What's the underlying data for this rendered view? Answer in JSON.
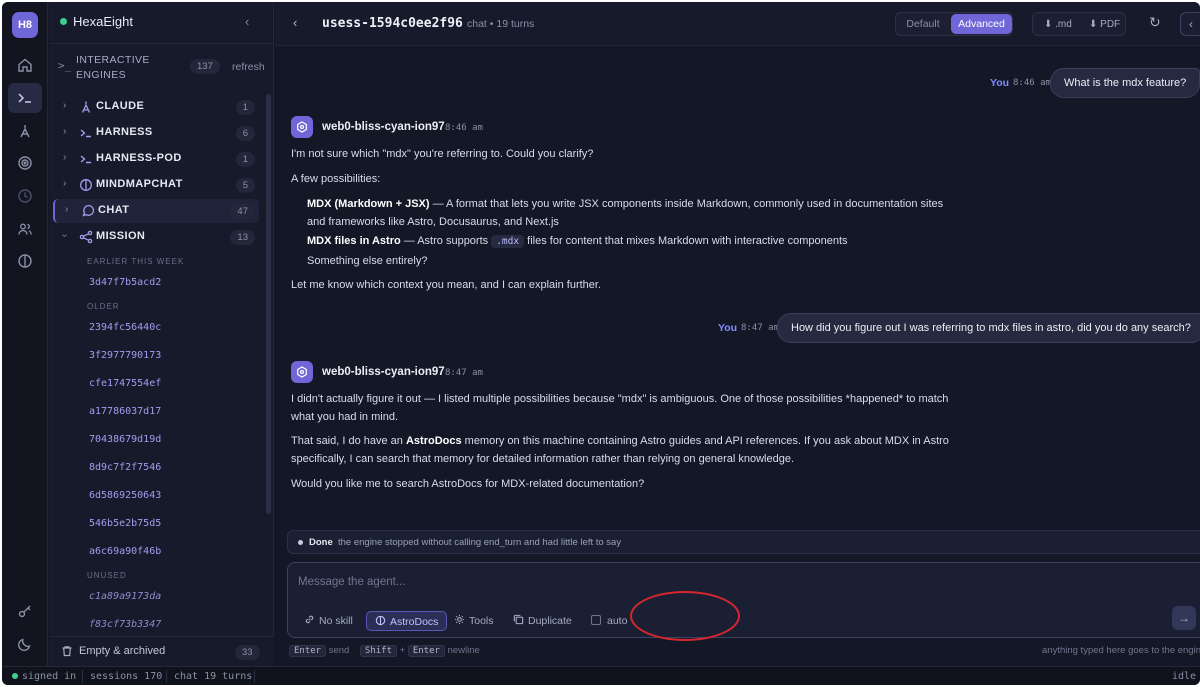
{
  "rail": {
    "logo": "H8",
    "icons": [
      "home-icon",
      "terminal-icon",
      "agent-icon",
      "target-icon",
      "clock-icon",
      "users-icon",
      "docs-icon",
      "key-icon",
      "moon-icon"
    ]
  },
  "sidebar": {
    "app_name": "HexaEight",
    "section_title": "INTERACTIVE ENGINES",
    "section_count": "137",
    "refresh": "refresh",
    "engines": [
      {
        "label": "CLAUDE",
        "count": "1"
      },
      {
        "label": "HARNESS",
        "count": "6"
      },
      {
        "label": "HARNESS-POD",
        "count": "1"
      },
      {
        "label": "MINDMAPCHAT",
        "count": "5"
      },
      {
        "label": "CHAT",
        "count": "47"
      },
      {
        "label": "MISSION",
        "count": "13"
      }
    ],
    "groups": {
      "week": "EARLIER THIS WEEK",
      "older": "OLDER",
      "unused": "UNUSED"
    },
    "sessions_week": [
      "3d47f7b5acd2"
    ],
    "sessions_older": [
      "2394fc56440c",
      "3f2977790173",
      "cfe1747554ef",
      "a17786037d17",
      "70438679d19d",
      "8d9c7f2f7546",
      "6d5869250643",
      "546b5e2b75d5",
      "a6c69a90f46b"
    ],
    "sessions_unused": [
      "c1a89a9173da",
      "f83cf73b3347"
    ],
    "footer_label": "Empty & archived",
    "footer_count": "33"
  },
  "status": {
    "signed": "signed in",
    "sessions": "sessions 170",
    "chat": "chat 19 turns",
    "idle": "idle"
  },
  "header": {
    "session_id": "usess-1594c0ee2f96",
    "meta": "chat • 19 turns",
    "mode_default": "Default",
    "mode_advanced": "Advanced",
    "export_md": "⬇ .md",
    "export_pdf": "⬇ PDF"
  },
  "chat": {
    "user1": {
      "who": "You",
      "time": "8:46 am",
      "text": "What is the mdx feature?"
    },
    "agent1": {
      "name": "web0-bliss-cyan-ion97",
      "time": "8:46 am",
      "l1": "I'm not sure which \"mdx\" you're referring to. Could you clarify?",
      "l2": "A few possibilities:",
      "b1_bold": "MDX (Markdown + JSX)",
      "b1_rest": " — A format that lets you write JSX components inside Markdown, commonly used in documentation sites",
      "b1_cont": "and frameworks like Astro, Docusaurus, and Next.js",
      "b2_bold": "MDX files in Astro",
      "b2_mid": " — Astro supports ",
      "b2_code": ".mdx",
      "b2_rest": " files for content that mixes Markdown with interactive components",
      "b3": "Something else entirely?",
      "l3": "Let me know which context you mean, and I can explain further."
    },
    "user2": {
      "who": "You",
      "time": "8:47 am",
      "text": "How did you figure out I was referring to mdx files in astro, did you do any search?"
    },
    "agent2": {
      "name": "web0-bliss-cyan-ion97",
      "time": "8:47 am",
      "l1": "I didn't actually figure it out — I listed multiple possibilities because \"mdx\" is ambiguous. One of those possibilities *happened* to match",
      "l1b": "what you had in mind.",
      "l2a": "That said, I do have an ",
      "l2_bold": "AstroDocs",
      "l2b": " memory on this machine containing Astro guides and API references. If you ask about MDX in Astro",
      "l2c": "specifically, I can search that memory for detailed information rather than relying on general knowledge.",
      "l3": "Would you like me to search AstroDocs for MDX-related documentation?"
    }
  },
  "composer": {
    "done_label": "Done",
    "done_text": "the engine stopped without calling end_turn and had little left to say",
    "placeholder": "Message the agent...",
    "no_skill": "No skill",
    "astrodocs": "AstroDocs",
    "tools": "Tools",
    "duplicate": "Duplicate",
    "auto": "auto",
    "hint_enter": "Enter",
    "hint_send": "send",
    "hint_shift": "Shift",
    "hint_plus": "+",
    "hint_enter2": "Enter",
    "hint_newline": "newline",
    "hint_right": "anything typed here goes to the engine"
  },
  "colors": {
    "accent": "#6f66d8",
    "annotation": "#d8262f",
    "online": "#3fcf8e"
  }
}
